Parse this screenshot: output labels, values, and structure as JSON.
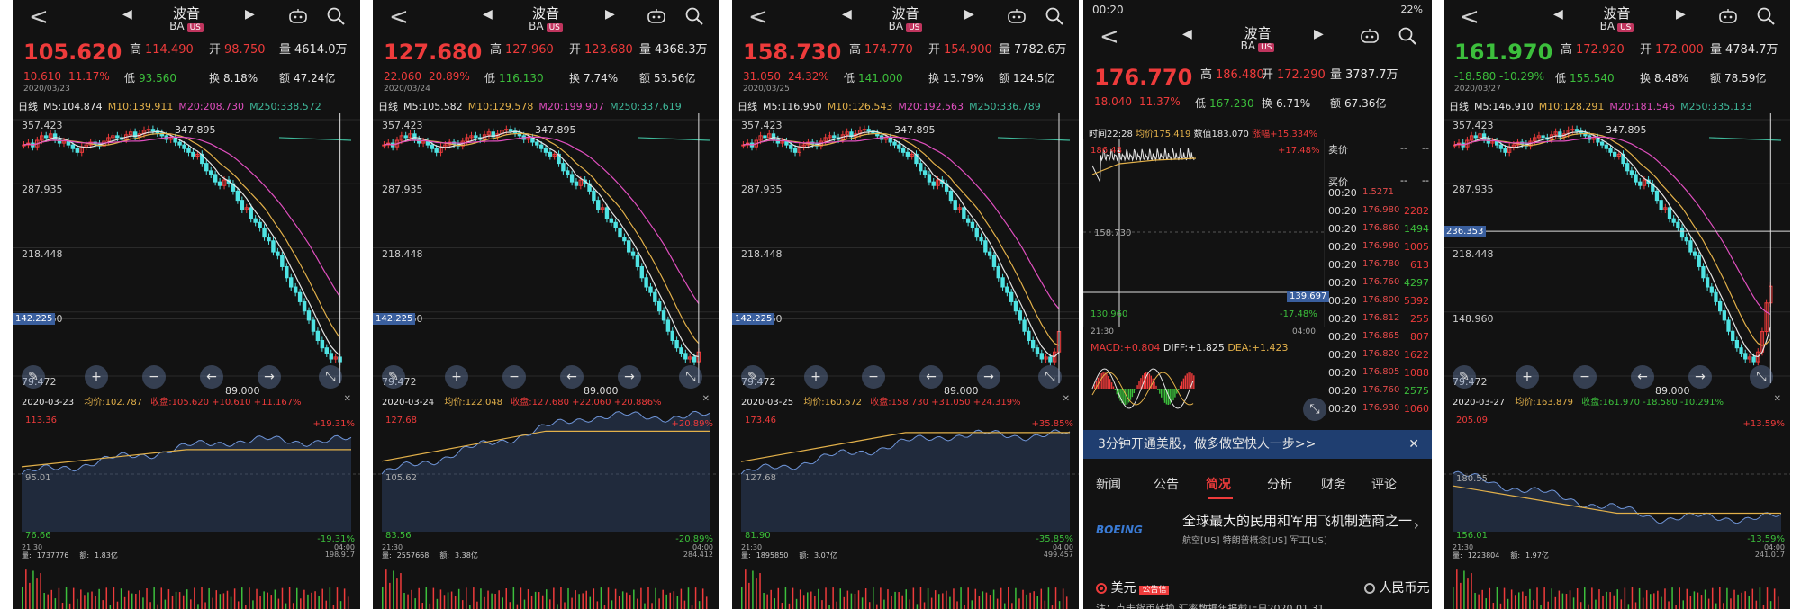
{
  "stock": {
    "name": "波音",
    "code": "BA",
    "market": "US",
    "nav_prev": "◀",
    "nav_next": "▶",
    "back": "<"
  },
  "labels": {
    "high": "高",
    "open": "开",
    "volume": "量",
    "low": "低",
    "turnover": "换",
    "amount": "额",
    "day": "日线",
    "avg": "均价:",
    "close": "收盘:",
    "vol_prefix": "量:",
    "amt_prefix": "额:"
  },
  "y_labels": [
    "357.423",
    "287.935",
    "218.448",
    "148.960",
    "79.472"
  ],
  "peak_label": "347.895",
  "bottom_label": "89.000",
  "time_start": "21:30",
  "time_end": "04:00",
  "panels": [
    {
      "price": "105.620",
      "high": "114.490",
      "open": "98.750",
      "volume": "4614.0万",
      "change": "10.610",
      "pct": "11.17%",
      "low": "93.560",
      "turn": "8.18%",
      "amount": "47.24亿",
      "date": "2020/03/23",
      "ma5": "M5:104.874",
      "ma10": "M10:139.911",
      "ma20": "M20:208.730",
      "ma250": "M250:338.572",
      "cursor": "142.225",
      "mini_date": "2020-03-23",
      "mini_avg": "102.787",
      "mini_close": "105.620 +10.610 +11.167%",
      "mini_hi": "113.36",
      "mini_mid": "95.01",
      "mini_lo": "76.66",
      "mini_up": "+19.31%",
      "mini_dn": "-19.31%",
      "vol": "1737776",
      "amt": "1.83亿",
      "cum": "198.917"
    },
    {
      "price": "127.680",
      "high": "127.960",
      "open": "123.680",
      "volume": "4368.3万",
      "change": "22.060",
      "pct": "20.89%",
      "low": "116.130",
      "turn": "7.74%",
      "amount": "53.56亿",
      "date": "2020/03/24",
      "ma5": "M5:105.582",
      "ma10": "M10:129.578",
      "ma20": "M20:199.907",
      "ma250": "M250:337.619",
      "cursor": "142.225",
      "mini_date": "2020-03-24",
      "mini_avg": "122.048",
      "mini_close": "127.680 +22.060 +20.886%",
      "mini_hi": "127.68",
      "mini_mid": "105.62",
      "mini_lo": "83.56",
      "mini_up": "+20.89%",
      "mini_dn": "-20.89%",
      "vol": "2557668",
      "amt": "3.38亿",
      "cum": "284.412"
    },
    {
      "price": "158.730",
      "high": "174.770",
      "open": "154.900",
      "volume": "7782.6万",
      "change": "31.050",
      "pct": "24.32%",
      "low": "141.000",
      "turn": "13.79%",
      "amount": "124.5亿",
      "date": "2020/03/25",
      "ma5": "M5:116.950",
      "ma10": "M10:126.543",
      "ma20": "M20:192.563",
      "ma250": "M250:336.789",
      "cursor": "142.225",
      "mini_date": "2020-03-25",
      "mini_avg": "160.672",
      "mini_close": "158.730 +31.050 +24.319%",
      "mini_hi": "173.46",
      "mini_mid": "127.68",
      "mini_lo": "81.90",
      "mini_up": "+35.85%",
      "mini_dn": "-35.85%",
      "vol": "1895850",
      "amt": "3.07亿",
      "cum": "499.457"
    },
    {
      "status_time": "00:20",
      "status_right": "22%",
      "price": "176.770",
      "high": "186.480",
      "open": "172.290",
      "volume": "3787.7万",
      "change": "18.040",
      "pct": "11.37%",
      "low": "167.230",
      "turn": "6.71%",
      "amount": "67.36亿",
      "t_time": "时间22:28",
      "t_avg": "均价175.419",
      "t_val": "数值183.070",
      "t_rise": "涨幅+15.334%",
      "t_hi": "186.48",
      "t_up": "+17.48%",
      "t_mid": "158.730",
      "t_cross": "139.697",
      "t_lo": "130.960",
      "t_dn": "-17.48%",
      "t_start": "21:30",
      "t_end": "04:00",
      "macd": "MACD:+0.804",
      "diff": "DIFF:+1.825",
      "dea": "DEA:+1.423",
      "sell": "卖价",
      "buy": "买价",
      "dash": "--",
      "trades": [
        [
          "00:20",
          "1.5271",
          "",
          ""
        ],
        [
          "00:20",
          "176.980",
          "2282",
          "red"
        ],
        [
          "00:20",
          "176.860",
          "1494",
          "grn"
        ],
        [
          "00:20",
          "176.980",
          "1005",
          "red"
        ],
        [
          "00:20",
          "176.780",
          "613",
          "red"
        ],
        [
          "00:20",
          "176.760",
          "4297",
          "grn"
        ],
        [
          "00:20",
          "176.800",
          "5392",
          "red"
        ],
        [
          "00:20",
          "176.812",
          "255",
          "red"
        ],
        [
          "00:20",
          "176.865",
          "807",
          "red"
        ],
        [
          "00:20",
          "176.820",
          "1622",
          "red"
        ],
        [
          "00:20",
          "176.805",
          "1088",
          "red"
        ],
        [
          "00:20",
          "176.760",
          "2575",
          "grn"
        ],
        [
          "00:20",
          "176.930",
          "1060",
          "red"
        ]
      ],
      "banner": "3分钟开通美股，做多做空快人一步>>",
      "tabs": [
        "新闻",
        "公告",
        "简况",
        "分析",
        "财务",
        "评论"
      ],
      "active_tab": "简况",
      "company_logo": "BOEING",
      "company_desc": "全球最大的民用和军用飞机制造商之一",
      "company_tags": "航空[US] 特朗普概念[US] 军工[US]",
      "currency_usd": "美元",
      "currency_badge": "公告信",
      "currency_rmb": "人民币元",
      "note": "注：点击货币转换 汇率数据年报截止日2020.01.31"
    },
    {
      "price": "161.970",
      "high": "172.920",
      "open": "172.000",
      "volume": "4784.7万",
      "change": "-18.580",
      "pct": "-10.29%",
      "low": "155.540",
      "turn": "8.48%",
      "amount": "78.59亿",
      "date": "2020/03/27",
      "ma5": "M5:146.910",
      "ma10": "M10:128.291",
      "ma20": "M20:181.546",
      "ma250": "M250:335.133",
      "cursor": "236.353",
      "mini_date": "2020-03-27",
      "mini_avg": "163.879",
      "mini_close": "161.970 -18.580 -10.291%",
      "mini_hi": "205.09",
      "mini_mid": "180.55",
      "mini_lo": "156.01",
      "mini_up": "+13.59%",
      "mini_dn": "-13.59%",
      "vol": "1223804",
      "amt": "1.97亿",
      "cum": "241.017"
    }
  ],
  "colors": {
    "up": "#ee3b3b",
    "down": "#3cbf3c",
    "candle_down": "#4fe3e3",
    "ma5": "#e5e5e5",
    "ma10": "#e3b14a",
    "ma20": "#e04fbf",
    "ma250": "#3fb89a",
    "bg": "#121212"
  },
  "icons": [
    "back-icon",
    "robot-icon",
    "search-icon",
    "zoom-in-icon",
    "zoom-out-icon",
    "prev-icon",
    "next-icon",
    "expand-icon",
    "close-icon"
  ]
}
